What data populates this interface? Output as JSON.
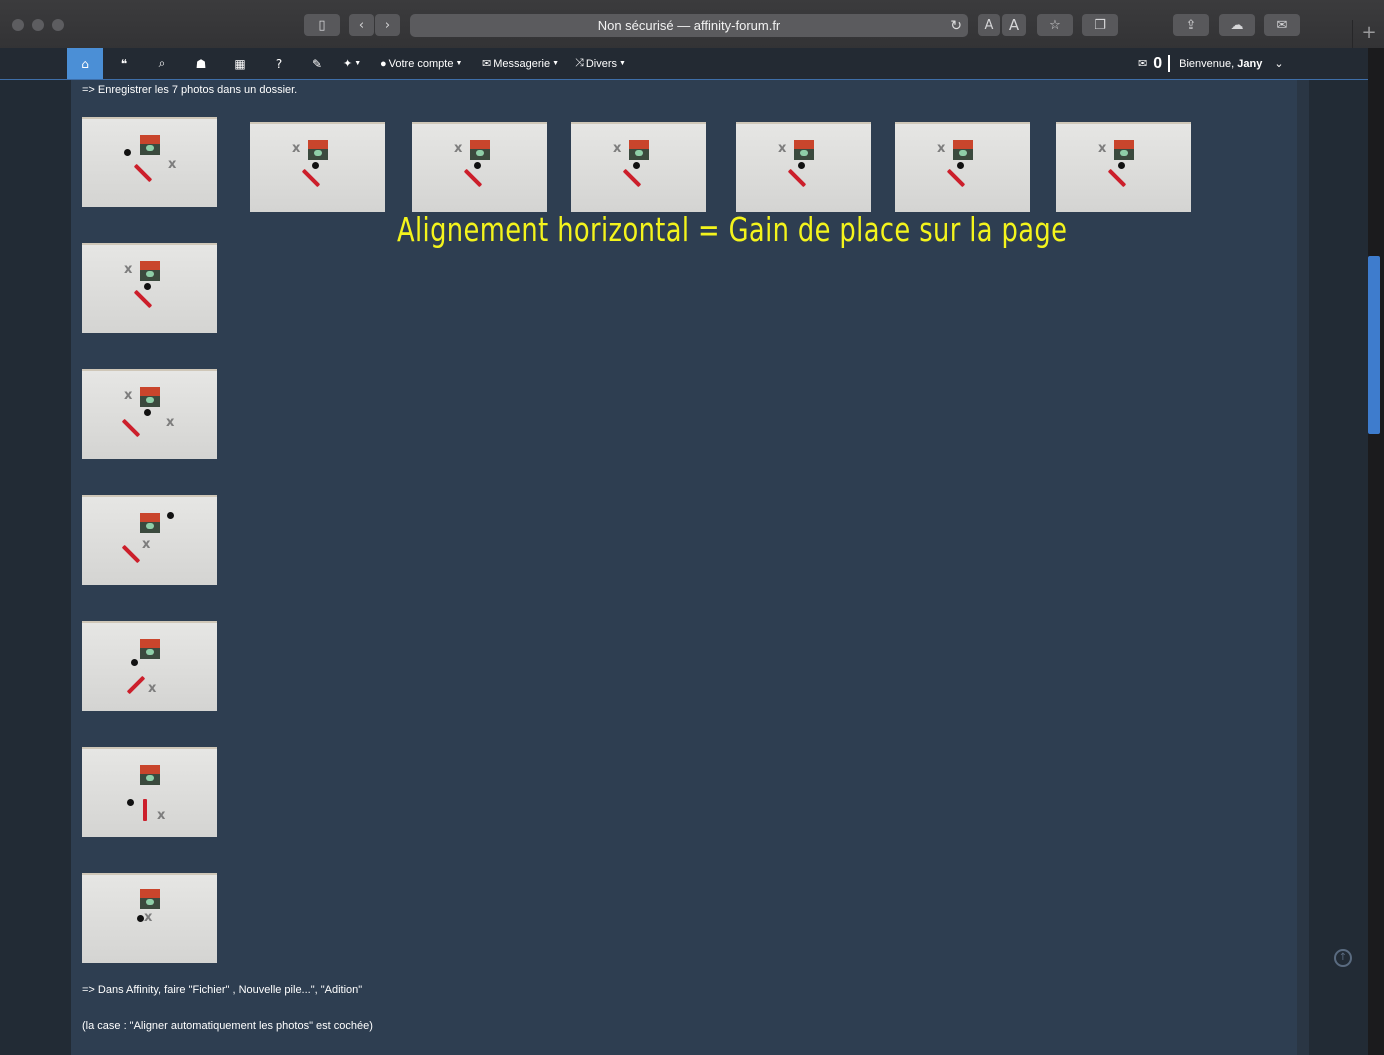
{
  "browser": {
    "url_text": "Non sécurisé — affinity-forum.fr",
    "reader_small": "A",
    "reader_large": "A",
    "new_tab": "+"
  },
  "navbar": {
    "menus": [
      {
        "label": "Votre compte"
      },
      {
        "label": "Messagerie"
      },
      {
        "label": "Divers"
      }
    ],
    "message_count": "0",
    "welcome_prefix": "Bienvenue, ",
    "username": "Jany"
  },
  "content": {
    "intro": "=> Enregistrer les 7 photos dans un dossier.",
    "overlay_title": "Alignement horizontal = Gain de place sur la page",
    "instruction": "=> Dans Affinity, faire \"Fichier\" , Nouvelle pile...\", \"Adition\"",
    "note": "(la case : \"Aligner automatiquement les photos\" est cochée)"
  },
  "colors": {
    "accent": "#4b8fd6",
    "overlay_text": "#f4f41c",
    "content_bg": "#2e3e51"
  }
}
